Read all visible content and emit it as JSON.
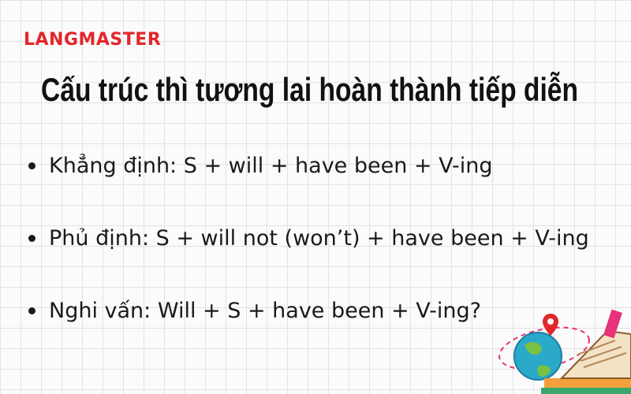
{
  "brand": {
    "name": "LANGMASTER"
  },
  "title": "Cấu trúc thì tương lai hoàn thành tiếp diễn",
  "bullets": [
    "Khẳng định: S + will + have been + V-ing",
    "Phủ định: S + will not (won’t) + have been + V-ing",
    "Nghi vấn: Will + S + have been + V-ing?"
  ],
  "decoration": {
    "icons": [
      "globe-icon",
      "map-pin-icon",
      "book-icon"
    ]
  }
}
